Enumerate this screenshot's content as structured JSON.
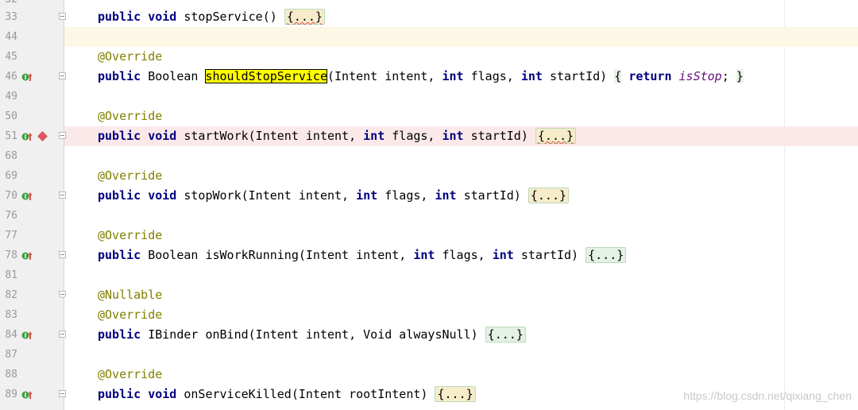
{
  "lines": [
    {
      "num": "32",
      "cls": "cut"
    },
    {
      "num": "33",
      "code": "stopService"
    },
    {
      "num": "44"
    },
    {
      "num": "45",
      "code": "@Override"
    },
    {
      "num": "46"
    },
    {
      "num": "49"
    },
    {
      "num": "50",
      "code": "@Override"
    },
    {
      "num": "51"
    },
    {
      "num": "68"
    },
    {
      "num": "69",
      "code": "@Override"
    },
    {
      "num": "70"
    },
    {
      "num": "76"
    },
    {
      "num": "77",
      "code": "@Override"
    },
    {
      "num": "78"
    },
    {
      "num": "81"
    },
    {
      "num": "82",
      "code": "@Nullable"
    },
    {
      "num": "83",
      "code": "@Override"
    },
    {
      "num": "84"
    },
    {
      "num": "87"
    },
    {
      "num": "88",
      "code": "@Override"
    },
    {
      "num": "89"
    }
  ],
  "tokens": {
    "public": "public",
    "void": "void",
    "int": "int",
    "return": "return",
    "Boolean": "Boolean",
    "IBinder": "IBinder",
    "Intent": "Intent",
    "Void": "Void",
    "override": "@Override",
    "nullable": "@Nullable",
    "folded": "{...}",
    "l33_rest": "stopService() ",
    "l46_name": "shouldStopService",
    "l46_params": "(Intent intent, ",
    "l46_flags": " flags, ",
    "l46_start": " startId) ",
    "l46_open": "{",
    "l46_field": "isStop",
    "l46_semi": "; ",
    "l46_close": "}",
    "l51_name": "startWork(Intent intent, ",
    "l51_flags": " flags, ",
    "l51_start": " startId) ",
    "l70_name": "stopWork(Intent intent, ",
    "l70_flags": " flags, ",
    "l70_start": " startId) ",
    "l78_name": "isWorkRunning(Intent intent, ",
    "l78_flags": " flags, ",
    "l78_start": " startId) ",
    "l84_name": "onBind(Intent intent, Void alwaysNull) ",
    "l89_name": "onServiceKilled(Intent rootIntent) "
  },
  "watermark": "https://blog.csdn.net/qixiang_chen",
  "colors": {
    "keyword": "#000080",
    "annotation": "#808000",
    "field": "#660e7a",
    "highlight": "#ffff00",
    "current_line": "#fdf8e5",
    "breakpoint_line": "#fbe9e9",
    "breakpoint_marker": "#db5860",
    "override_marker": "#3e9e3e"
  },
  "icons": {
    "override": "implements-override-icon",
    "breakpoint": "breakpoint-diamond-icon",
    "fold": "fold-toggle-icon"
  }
}
